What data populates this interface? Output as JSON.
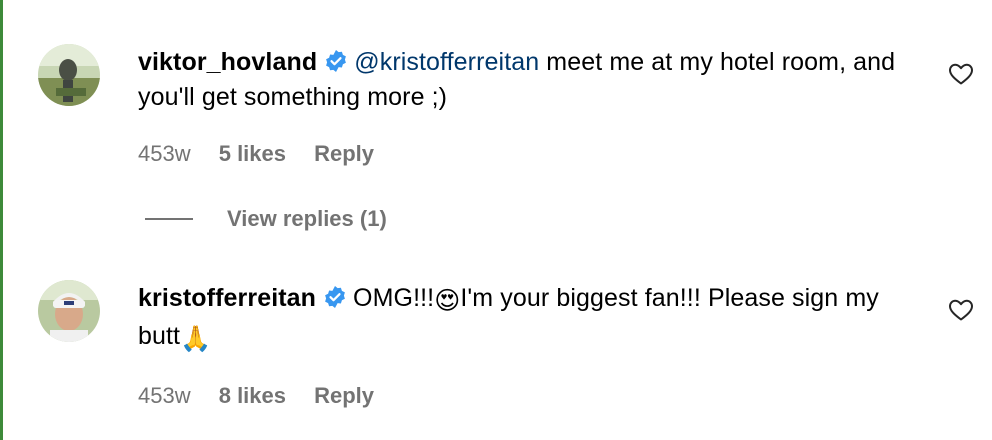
{
  "comments": [
    {
      "username": "viktor_hovland",
      "mention": "@kristofferreitan",
      "text": " meet me at my hotel room, and you'll get something more ;)",
      "time": "453w",
      "likes": "5 likes",
      "reply": "Reply",
      "verified": true
    },
    {
      "username": "kristofferreitan",
      "text_before": "OMG!!!",
      "emoji1": "😍",
      "text_after": "I'm your biggest fan!!! Please sign my butt",
      "emoji2": "🙏",
      "time": "453w",
      "likes": "8 likes",
      "reply": "Reply",
      "verified": true
    }
  ],
  "view_replies": "View replies (1)",
  "colors": {
    "verified": "#3897f0",
    "meta": "#737373",
    "mention": "#00376b"
  }
}
